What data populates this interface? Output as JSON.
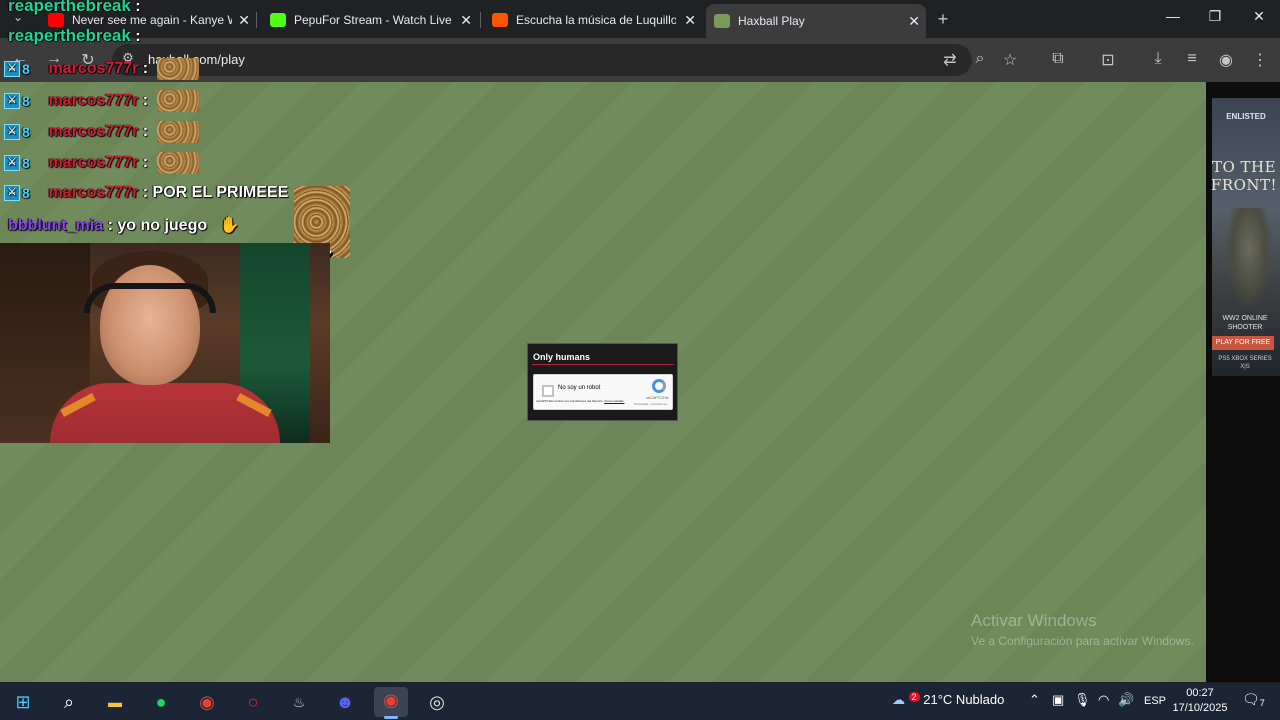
{
  "browser": {
    "tabs": [
      {
        "title": "Never see me again - Kanye We",
        "favicon_color": "#ff0000"
      },
      {
        "title": "PepuFor Stream - Watch Live o",
        "favicon_color": "#53fc18"
      },
      {
        "title": "Escucha la música de Luquillov",
        "favicon_color": "#ff5500"
      },
      {
        "title": "Haxball Play",
        "favicon_color": "#7a9a5a"
      }
    ],
    "url": "haxball.com/play"
  },
  "chat": {
    "lines": [
      {
        "user": "reaperthebreak",
        "text": ""
      },
      {
        "user": "reaperthebreak",
        "text": ""
      },
      {
        "user": "marcos777r",
        "text": ""
      },
      {
        "user": "marcos777r",
        "text": ""
      },
      {
        "user": "marcos777r",
        "text": ""
      },
      {
        "user": "marcos777r",
        "text": ""
      },
      {
        "user": "marcos777r",
        "text": "POR EL PRIMEEE"
      },
      {
        "user": "bbblunt_mia",
        "text": "yo no juego"
      }
    ],
    "separator": ":",
    "multiplier": "x7"
  },
  "captcha": {
    "title": "Only humans",
    "checkbox_label": "No soy un robot",
    "brand": "reCAPTCHA",
    "privacy": "Privacidad - Condiciones",
    "legal": "reCAPTCHA cambió sus Condiciones del Servicio.",
    "legal_link": "Toma medidas."
  },
  "ad": {
    "logo": "ENLISTED",
    "headline": "TO THE FRONT!",
    "subtitle": "WW2 ONLINE SHOOTER",
    "cta": "PLAY FOR FREE",
    "platforms": "PS5 XBOX SERIES X|S"
  },
  "watermark": {
    "title": "Activar Windows",
    "subtitle": "Ve a Configuración para activar Windows."
  },
  "taskbar": {
    "weather_badge": "2",
    "weather": "21°C  Nublado",
    "language": "ESP",
    "time": "00:27",
    "date": "17/10/2025",
    "notifications": "7"
  }
}
